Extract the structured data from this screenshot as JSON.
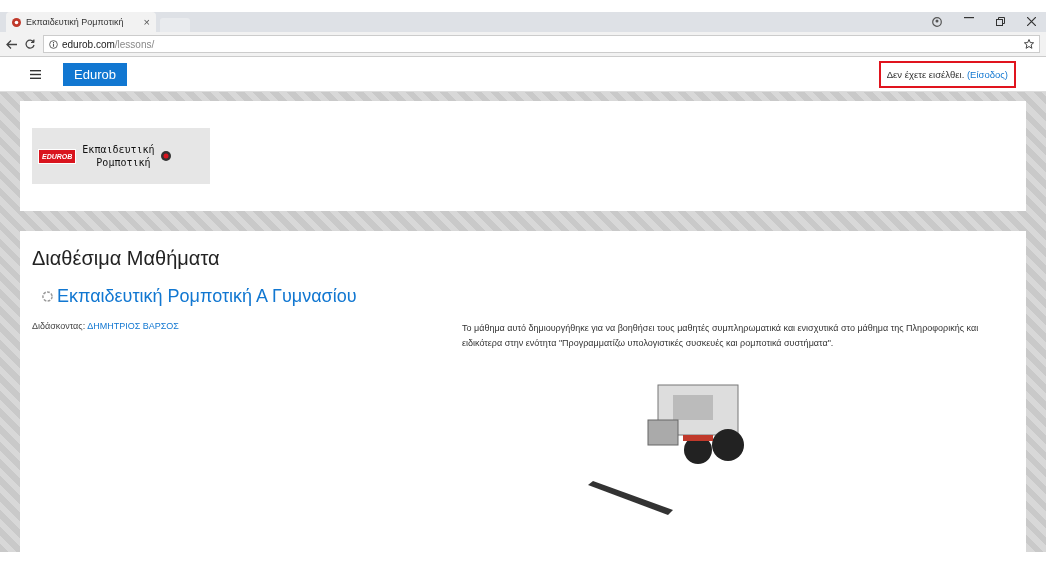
{
  "browser": {
    "tabs": [
      {
        "title": "Εκπαιδευτική Ρομποτική",
        "close": "×",
        "selected": true
      }
    ],
    "url_host": "edurob.com",
    "url_path": "/lessons/"
  },
  "navbar": {
    "brand": "Edurob",
    "login_status": "Δεν έχετε εισέλθει.",
    "login_link": "(Είσοδος)",
    "highlighted": true
  },
  "logo": {
    "badge": "EDUROB",
    "line_1": "Εκπαιδευτική",
    "line_2": "Ρομποτική"
  },
  "content": {
    "heading": "Διαθέσιμα Μαθήματα",
    "course": {
      "title": "Εκπαιδευτική Ρομποτική Α Γυμνασίου",
      "teacher_label": "Διδάσκοντας:",
      "teacher": "ΔΗΜΗΤΡΙΟΣ ΒΑΡΣΟΣ",
      "description": "Το μάθημα αυτό δημιουργήθηκε για να βοηθήσει τους μαθητές συμπληρωματικά και ενισχυτικά στο μάθημα της Πληροφορικής και ειδικότερα στην ενότητα \"Προγραμματίζω υπολογιστικές συσκευές και ρομποτικά συστήματα\"."
    }
  }
}
